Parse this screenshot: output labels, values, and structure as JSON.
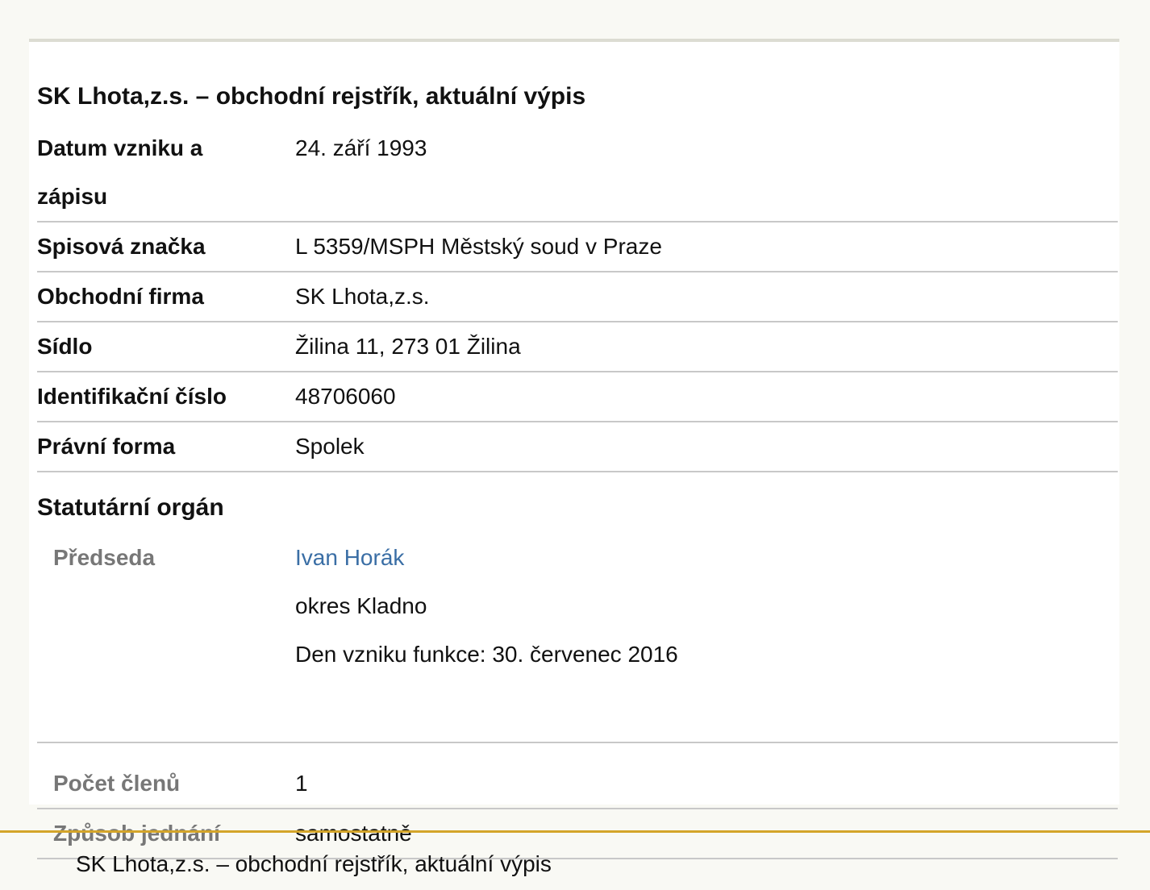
{
  "heading": "SK Lhota,z.s. – obchodní rejstřík, aktuální výpis",
  "rows": [
    {
      "label": "Datum vzniku a zápisu",
      "value": "24. září 1993"
    },
    {
      "label": "Spisová značka",
      "value": "L 5359/MSPH Městský soud v Praze"
    },
    {
      "label": "Obchodní firma",
      "value": "SK Lhota,z.s."
    },
    {
      "label": "Sídlo",
      "value": "Žilina 11, 273 01 Žilina"
    },
    {
      "label": "Identifikační číslo",
      "value": "48706060"
    },
    {
      "label": "Právní forma",
      "value": "Spolek"
    }
  ],
  "statutory": {
    "title": "Statutární orgán",
    "chair": {
      "label": "Předseda",
      "name": "Ivan Horák",
      "district": "okres Kladno",
      "since": "Den vzniku funkce: 30. červenec 2016"
    },
    "members": {
      "label": "Počet členů",
      "value": "1"
    },
    "acting": {
      "label": "Způsob jednání",
      "value": "samostatně"
    }
  },
  "footer": {
    "text": "SK Lhota,z.s. – obchodní rejstřík, aktuální výpis"
  },
  "colors": {
    "link": "#3a6ea5",
    "footer_rule": "#d4a52a",
    "sub_label": "#777777"
  }
}
